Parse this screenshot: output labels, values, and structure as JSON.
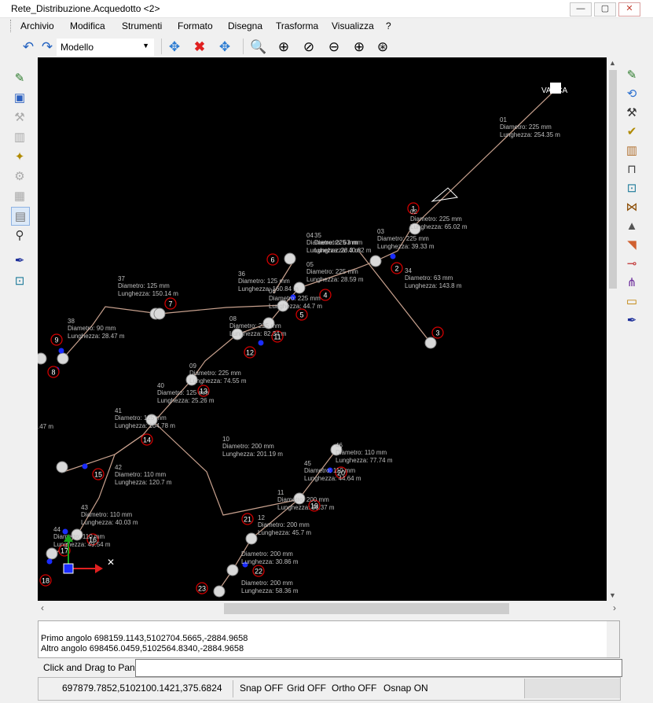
{
  "window": {
    "title": "Rete_Distribuzione.Acquedotto <2>",
    "minimize": "—",
    "maximize": "▢",
    "close": "✕"
  },
  "menu": [
    "Archivio",
    "Modifica",
    "Strumenti",
    "Formato",
    "Disegna",
    "Trasforma",
    "Visualizza",
    "?"
  ],
  "toolbar": {
    "space_combo": "Modello",
    "icons": [
      "undo-icon",
      "redo-icon",
      "pan-move-icon",
      "delete-icon",
      "add-node-icon",
      "zoom-window-icon",
      "zoom-center-icon",
      "zoom-previous-icon",
      "zoom-out-icon",
      "zoom-in-icon",
      "zoom-realtime-icon"
    ]
  },
  "canvas": {
    "background": "#000000",
    "pipe_color": "#c8a18e",
    "node_color": "#d9d9d9",
    "tag_color": "#d00000",
    "point_color": "#1a2cff",
    "tank_label": "VASCA",
    "pipes": [
      {
        "id": "01",
        "diam": "Diametro: 225 mm",
        "len": "Lunghezza: 254.35 m"
      },
      {
        "id": "02",
        "diam": "Diametro: 225 mm",
        "len": "Lunghezza: 65.02 m"
      },
      {
        "id": "03",
        "diam": "Diametro: 225 mm",
        "len": "Lunghezza: 39.33 m"
      },
      {
        "id": "04",
        "diam": "Diametro: 225 mm",
        "len": "Lunghezza: 28.3 m"
      },
      {
        "id": "05",
        "diam": "Diametro: 225 mm",
        "len": "Lunghezza: 28.59 m"
      },
      {
        "id": "06",
        "diam": "Diametro: 225 mm",
        "len": "Lunghezza: 44.7 m"
      },
      {
        "id": "08",
        "diam": "Diametro: 225 mm",
        "len": "Lunghezza: 82.34 m"
      },
      {
        "id": "09",
        "diam": "Diametro: 225 mm",
        "len": "Lunghezza: 74.55 m"
      },
      {
        "id": "10",
        "diam": "Diametro: 200 mm",
        "len": "Lunghezza: 201.19 m"
      },
      {
        "id": "11",
        "diam": "Diametro: 200 mm",
        "len": "Lunghezza: 36.37 m"
      },
      {
        "id": "12",
        "diam": "Diametro: 200 mm",
        "len": "Lunghezza: 45.7 m"
      },
      {
        "id": "34",
        "diam": "Diametro: 63 mm",
        "len": "Lunghezza: 143.8 m"
      },
      {
        "id": "35",
        "diam": "Diametro: 63 mm",
        "len": "Lunghezza: 40.82 m"
      },
      {
        "id": "36",
        "diam": "Diametro: 125 mm",
        "len": "Lunghezza: 160.84 m"
      },
      {
        "id": "37",
        "diam": "Diametro: 125 mm",
        "len": "Lunghezza: 150.14 m"
      },
      {
        "id": "38",
        "diam": "Diametro: 90 mm",
        "len": "Lunghezza: 28.47 m"
      },
      {
        "id": "40",
        "diam": "Diametro: 125 mm",
        "len": "Lunghezza: 25.26 m"
      },
      {
        "id": "41",
        "diam": "Diametro: 125 mm",
        "len": "Lunghezza: 104.78 m"
      },
      {
        "id": "42",
        "diam": "Diametro: 110 mm",
        "len": "Lunghezza: 120.7 m"
      },
      {
        "id": "43",
        "diam": "Diametro: 110 mm",
        "len": "Lunghezza: 40.03 m"
      },
      {
        "id": "44",
        "diam": "Diametro: 110 mm",
        "len": "Lunghezza: 49.54 m"
      },
      {
        "id": "45",
        "diam": "Diametro: 110 mm",
        "len": "Lunghezza: 44.64 m"
      },
      {
        "id": "46",
        "diam": "Diametro: 110 mm",
        "len": "Lunghezza: 77.74 m"
      },
      {
        "id": "",
        "diam": "Diametro: 200 mm",
        "len": "Lunghezza: 30.86 m"
      },
      {
        "id": "",
        "diam": "Diametro: 200 mm",
        "len": "Lunghezza: 58.36 m"
      }
    ],
    "node_tags": [
      "1",
      "2",
      "3",
      "4",
      "5",
      "6",
      "7",
      "8",
      "9",
      "11",
      "12",
      "13",
      "14",
      "15",
      "16",
      "17",
      "18",
      "19",
      "20",
      "21",
      "22",
      "23"
    ],
    "edge_fragment": ".47 m"
  },
  "console": {
    "line1": "Primo angolo 698159.1143,5102704.5665,-2884.9658",
    "line2": "Altro angolo 698456.0459,5102564.8340,-2884.9658"
  },
  "command": {
    "prompt": "Click and Drag to Pan:",
    "value": ""
  },
  "status": {
    "coords": "697879.7852,5102100.1421,375.6824",
    "snap": "Snap OFF",
    "grid": "Grid OFF",
    "ortho": "Ortho OFF",
    "osnap": "Osnap ON"
  }
}
